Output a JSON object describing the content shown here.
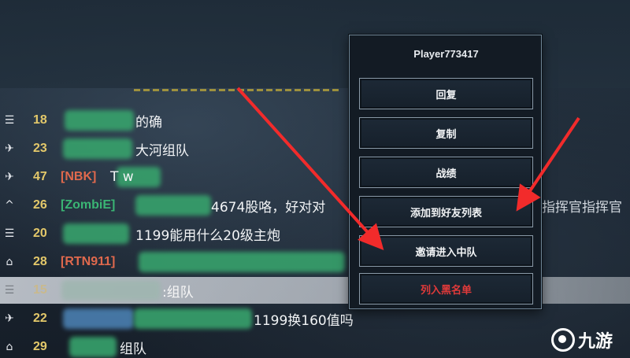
{
  "chat": {
    "rows": [
      {
        "icon": "☰",
        "level": "18",
        "tag": "",
        "message": "的确"
      },
      {
        "icon": "✈",
        "level": "23",
        "tag": "",
        "message": "大河组队"
      },
      {
        "icon": "✈",
        "level": "47",
        "tag": "[NBK]",
        "message": "T          w"
      },
      {
        "icon": "^",
        "level": "26",
        "tag": "[ZombiE]",
        "message": "4674股咯，好对对",
        "message_tail": "指挥官指挥官"
      },
      {
        "icon": "☰",
        "level": "20",
        "tag": "",
        "message": "1199能用什么20级主炮"
      },
      {
        "icon": "⌂",
        "level": "28",
        "tag": "[RTN911]",
        "message": ""
      },
      {
        "icon": "☰",
        "level": "15",
        "tag": "",
        "message": ":组队"
      },
      {
        "icon": "✈",
        "level": "22",
        "tag": "",
        "message": "1199换160值吗"
      },
      {
        "icon": "⌂",
        "level": "29",
        "tag": "",
        "message": "组队"
      }
    ]
  },
  "popup": {
    "title": "Player773417",
    "buttons": [
      {
        "label": "回复",
        "danger": false
      },
      {
        "label": "复制",
        "danger": false
      },
      {
        "label": "战绩",
        "danger": false
      },
      {
        "label": "添加到好友列表",
        "danger": false
      },
      {
        "label": "邀请进入中队",
        "danger": false
      },
      {
        "label": "列入黑名单",
        "danger": true
      }
    ]
  },
  "colors": {
    "accent_red": "#e23a3a",
    "level_gold": "#e3c86a",
    "tag_red": "#e0694d"
  },
  "watermark": {
    "text": "九游"
  }
}
